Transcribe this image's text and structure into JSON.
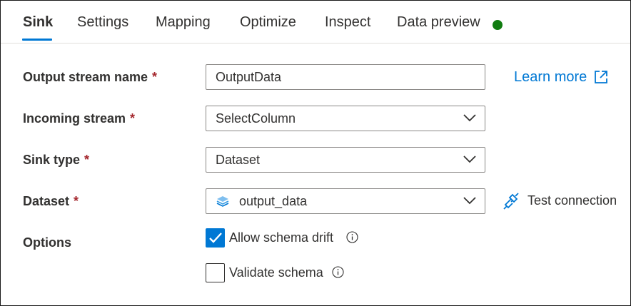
{
  "tabs": [
    {
      "label": "Sink",
      "active": true
    },
    {
      "label": "Settings",
      "active": false
    },
    {
      "label": "Mapping",
      "active": false
    },
    {
      "label": "Optimize",
      "active": false
    },
    {
      "label": "Inspect",
      "active": false
    },
    {
      "label": "Data preview",
      "active": false
    }
  ],
  "status": {
    "icon": "status-dot-icon",
    "color": "#107c10"
  },
  "form": {
    "output_stream_name": {
      "label": "Output stream name",
      "required": "*",
      "value": "OutputData"
    },
    "incoming_stream": {
      "label": "Incoming stream",
      "required": "*",
      "value": "SelectColumn"
    },
    "sink_type": {
      "label": "Sink type",
      "required": "*",
      "value": "Dataset"
    },
    "dataset": {
      "label": "Dataset",
      "required": "*",
      "value": "output_data",
      "icon": "dataset-icon"
    },
    "options": {
      "label": "Options"
    }
  },
  "learn_more": {
    "label": "Learn more",
    "icon": "external-link-icon"
  },
  "test_connection": {
    "label": "Test connection",
    "icon": "plug-connection-icon"
  },
  "checkboxes": {
    "allow_schema_drift": {
      "label": "Allow schema drift",
      "checked": true
    },
    "validate_schema": {
      "label": "Validate schema",
      "checked": false
    }
  },
  "colors": {
    "accent": "#0078d4",
    "required": "#a4262c",
    "status": "#107c10"
  }
}
